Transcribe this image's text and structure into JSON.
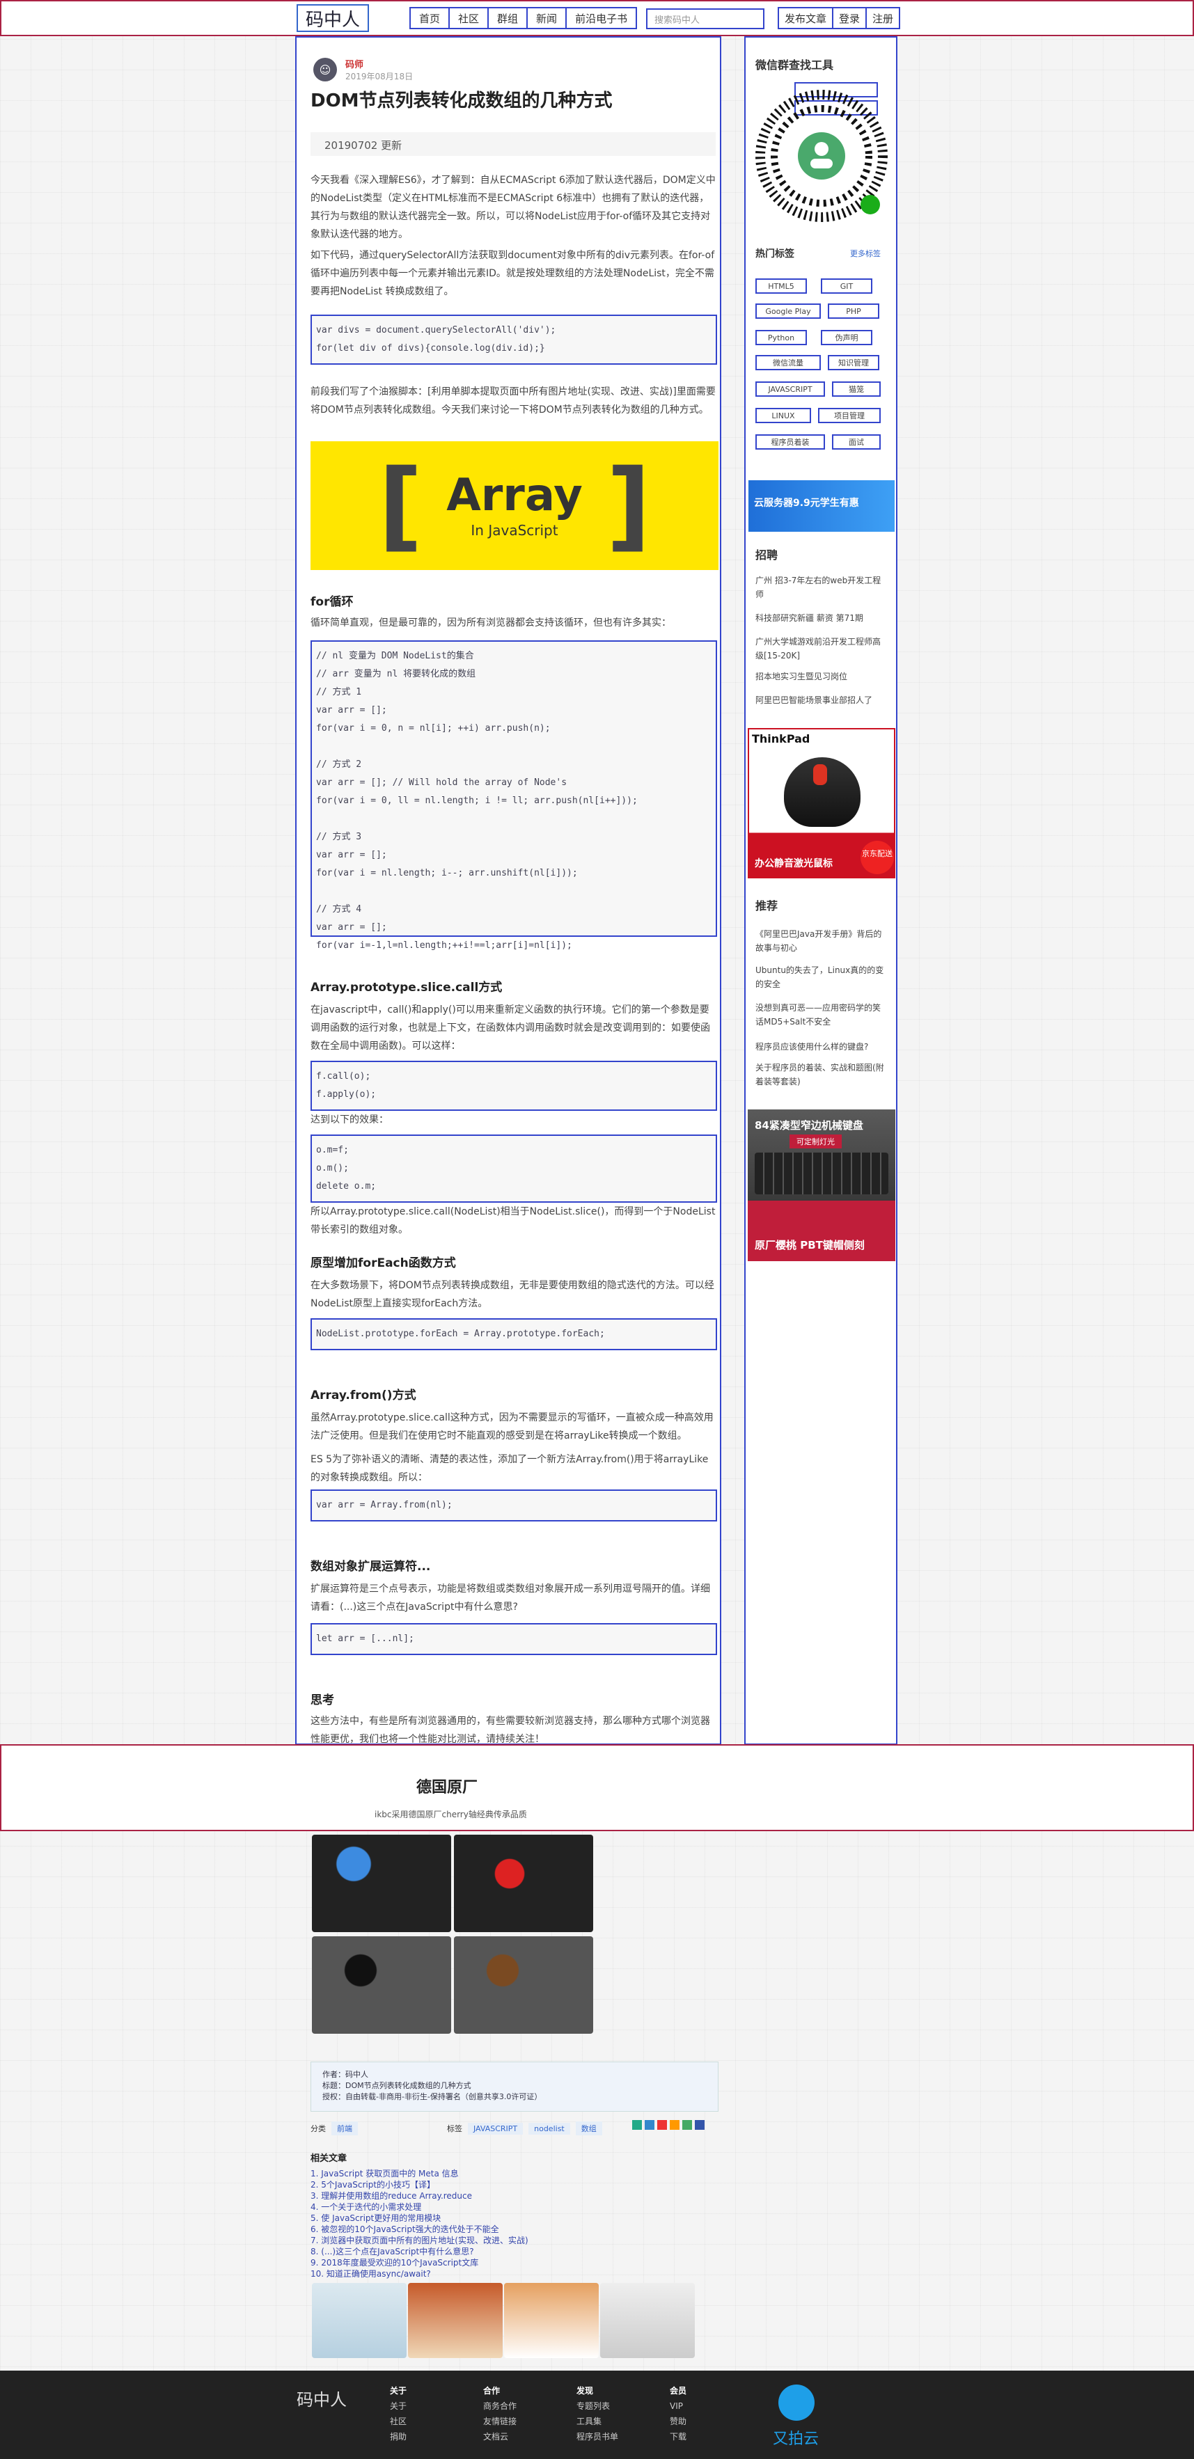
{
  "header": {
    "logo": "码中人",
    "nav": [
      "首页",
      "社区",
      "群组",
      "新闻",
      "前沿电子书"
    ],
    "search_placeholder": "搜索码中人",
    "right": [
      "发布文章",
      "登录",
      "注册"
    ]
  },
  "article": {
    "author_name": "码师",
    "author_date": "2019年08月18日",
    "title": "DOM节点列表转化成数组的几种方式",
    "update": "20190702 更新",
    "p1": "今天我看《深入理解ES6》，才了解到：自从ECMAScript 6添加了默认迭代器后，DOM定义中的NodeList类型（定义在HTML标准而不是ECMAScript 6标准中）也拥有了默认的迭代器，其行为与数组的默认迭代器完全一致。所以，可以将NodeList应用于for-of循环及其它支持对象默认迭代器的地方。",
    "p2": "如下代码，通过querySelectorAll方法获取到document对象中所有的div元素列表。在for-of循环中遍历列表中每一个元素并输出元素ID。就是按处理数组的方法处理NodeList，完全不需要再把NodeList 转换成数组了。",
    "code1": [
      "var divs = document.querySelectorAll('div');",
      "for(let div of divs){console.log(div.id);}"
    ],
    "p3": "前段我们写了个油猴脚本：[利用单脚本提取页面中所有图片地址(实现、改进、实战)]里面需要将DOM节点列表转化成数组。今天我们来讨论一下将DOM节点列表转化为数组的几种方式。",
    "hero_word": "Array",
    "hero_sub": "In JavaScript",
    "h_for": "for循环",
    "p_for": "循环简单直观，但是最可靠的，因为所有浏览器都会支持该循环，但也有许多其实：",
    "code2": [
      "// nl 变量为 DOM NodeList的集合",
      "// arr 变量为 nl 将要转化成的数组",
      "// 方式 1",
      "var arr = [];",
      "for(var i = 0, n = nl[i]; ++i) arr.push(n);",
      "",
      "// 方式 2",
      "var arr = []; // Will hold the array of Node's",
      "for(var i = 0, ll = nl.length; i != ll; arr.push(nl[i++]));",
      "",
      "// 方式 3",
      "var arr = [];",
      "for(var i = nl.length; i--; arr.unshift(nl[i]));",
      "",
      "// 方式 4",
      "var arr = [];",
      "for(var i=-1,l=nl.length;++i!==l;arr[i]=nl[i]);"
    ],
    "h_slice": "Array.prototype.slice.call方式",
    "p_slice": "在javascript中，call()和apply()可以用来重新定义函数的执行环境。它们的第一个参数是要调用函数的运行对象，也就是上下文，在函数体内调用函数时就会是改变调用到的：如要使函数在全局中调用函数)。可以这样：",
    "code3": [
      "f.call(o);",
      "f.apply(o);"
    ],
    "p_equiv": "达到以下的效果：",
    "code4": [
      "o.m=f;",
      "o.m();",
      "delete o.m;"
    ],
    "p_slice2": "所以Array.prototype.slice.call(NodeList)相当于NodeList.slice()，而得到一个于NodeList带长索引的数组对象。",
    "h_foreach": "原型增加forEach函数方式",
    "p_foreach": "在大多数场景下，将DOM节点列表转换成数组，无非是要使用数组的隐式迭代的方法。可以经NodeList原型上直接实现forEach方法。",
    "code5": [
      "NodeList.prototype.forEach = Array.prototype.forEach;"
    ],
    "h_from": "Array.from()方式",
    "p_from1": "虽然Array.prototype.slice.call这种方式，因为不需要显示的写循环，一直被众成一种高效用法广泛使用。但是我们在使用它时不能直观的感受到是在将arrayLike转换成一个数组。",
    "p_from2": "ES 5为了弥补语义的清晰、清楚的表达性，添加了一个新方法Array.from()用于将arrayLike的对象转换成数组。所以：",
    "code6": [
      "var arr = Array.from(nl);"
    ],
    "h_spread": "数组对象扩展运算符...",
    "p_spread": "扩展运算符是三个点号表示，功能是将数组或类数组对象展开成一系列用逗号隔开的值。详细请看：(...)这三个点在JavaScript中有什么意思?",
    "code7": [
      "let arr = [...nl];"
    ],
    "h_think": "思考",
    "p_think": "这些方法中，有些是所有浏览器通用的，有些需要较新浏览器支持，那么哪种方式哪个浏览器性能更优，我们也将一个性能对比测试，请持续关注！"
  },
  "ad_band": {
    "title": "德国原厂",
    "sub": "ikbc采用德国原厂cherry轴经典传承品质"
  },
  "copyright": {
    "author": "作者：码中人",
    "title": "标题：DOM节点列表转化成数组的几种方式",
    "license": "授权：自由转载-非商用-非衍生-保持署名（创意共享3.0许可证）"
  },
  "meta": {
    "cat_label": "分类",
    "cat": "前端",
    "tag_label": "标签",
    "tags": [
      "JAVASCRIPT",
      "nodelist",
      "数组"
    ]
  },
  "related": {
    "title": "相关文章",
    "items": [
      "1. JavaScript 获取页面中的 Meta 信息",
      "2. 5个JavaScript的小技巧【译】",
      "3. 理解并使用数组的reduce Array.reduce",
      "4. 一个关于迭代的小需求处理",
      "5. 使 JavaScript更好用的常用模块",
      "6. 被忽视的10个JavaScript强大的迭代处于不能全",
      "7. 浏览器中获取页面中所有的图片地址(实现、改进、实战)",
      "8. (...)这三个点在JavaScript中有什么意思?",
      "9. 2018年度最受欢迎的10个JavaScript文库",
      "10. 知道正确使用async/await?"
    ]
  },
  "sidebar": {
    "wechat_title": "微信群查找工具",
    "hot_title": "热门标签",
    "hot_more": "更多标签",
    "tags": [
      "HTML5",
      "GIT",
      "Google Play",
      "PHP",
      "Python",
      "伪声明",
      "微信流量",
      "知识管理",
      "JAVASCRIPT",
      "猫笼",
      "LINUX",
      "项目管理",
      "程序员着装",
      "面试"
    ],
    "cloud_ad": "云服务器9.9元学生有惠",
    "job_title": "招聘",
    "jobs": [
      "广州 招3-7年左右的web开发工程师",
      "科技部研究新疆 薪资 第71期",
      "广州大学城游戏前沿开发工程师高级[15-20K]",
      "招本地实习生暨见习岗位",
      "阿里巴巴智能场景事业部招人了"
    ],
    "ad_mouse_brand": "ThinkPad",
    "ad_mouse_caption": "办公静音激光鼠标",
    "ad_mouse_tag": "京东配送",
    "rec_title": "推荐",
    "recs": [
      "《阿里巴巴Java开发手册》背后的故事与初心",
      "Ubuntu的失去了，Linux真的的变的安全",
      "没想到真可恶——应用密码学的笑话MD5+Salt不安全",
      "程序员应该使用什么样的键盘?",
      "关于程序员的着装、实战和题图(附着装等套装)"
    ],
    "ad_kb_title": "84紧凑型窄边机械键盘",
    "ad_kb_sub": "可定制灯光",
    "ad_kb_bottom": "原厂樱桃 PBT键帽侧刻"
  },
  "footer": {
    "logo": "码中人",
    "cols": [
      {
        "title": "关于",
        "items": [
          "关于",
          "社区",
          "捐助"
        ]
      },
      {
        "title": "合作",
        "items": [
          "商务合作",
          "友情链接",
          "文档云"
        ]
      },
      {
        "title": "发现",
        "items": [
          "专题列表",
          "工具集",
          "程序员书单"
        ]
      },
      {
        "title": "会员",
        "items": [
          "VIP",
          "赞助",
          "下载"
        ]
      }
    ],
    "partner": "又拍云"
  }
}
